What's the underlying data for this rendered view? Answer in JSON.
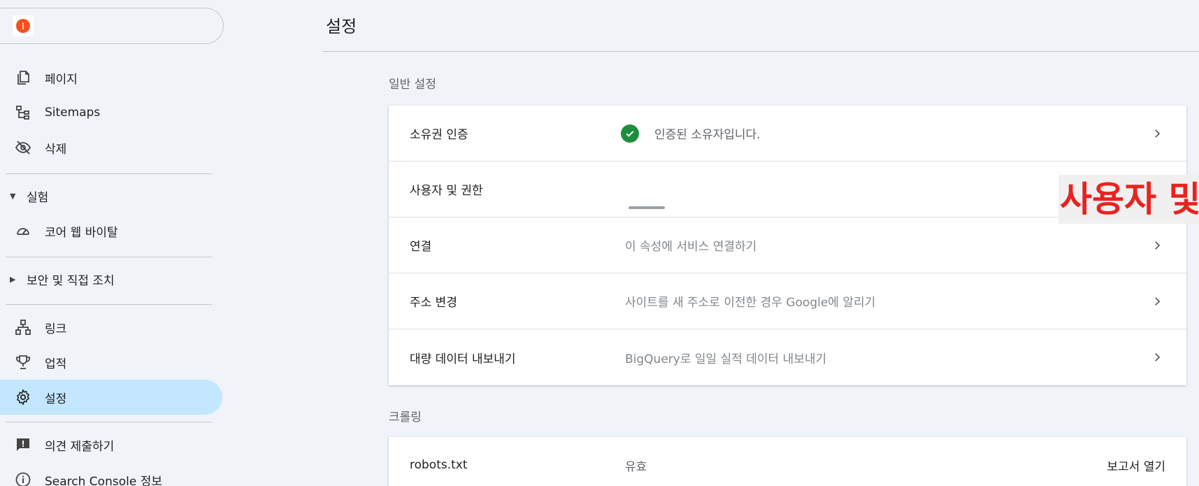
{
  "sidebar": {
    "property_logo_glyph": "⋮",
    "items": [
      {
        "label": "페이지",
        "icon": "pages-icon"
      },
      {
        "label": "Sitemaps",
        "icon": "sitemap-icon"
      },
      {
        "label": "삭제",
        "icon": "visibility-off-icon"
      }
    ],
    "group_experiment": {
      "label": "실험"
    },
    "experiment_items": [
      {
        "label": "코어 웹 바이탈",
        "icon": "speed-icon"
      }
    ],
    "group_security": {
      "label": "보안 및 직접 조치"
    },
    "bottom_items": [
      {
        "label": "링크",
        "icon": "links-icon"
      },
      {
        "label": "업적",
        "icon": "trophy-icon"
      },
      {
        "label": "설정",
        "icon": "gear-icon",
        "active": true
      }
    ],
    "footer_items": [
      {
        "label": "의견 제출하기",
        "icon": "feedback-icon"
      },
      {
        "label": "Search Console 정보",
        "icon": "info-icon"
      }
    ]
  },
  "main": {
    "title": "설정",
    "general": {
      "heading": "일반 설정",
      "rows": [
        {
          "label": "소유권 인증",
          "value": "인증된 소유자입니다."
        },
        {
          "label": "사용자 및 권한",
          "value": ""
        },
        {
          "label": "연결",
          "value": "이 속성에 서비스 연결하기"
        },
        {
          "label": "주소 변경",
          "value": "사이트를 새 주소로 이전한 경우 Google에 알리기"
        },
        {
          "label": "대량 데이터 내보내기",
          "value": "BigQuery로 일일 실적 데이터 내보내기"
        }
      ]
    },
    "crawling": {
      "heading": "크롤링",
      "rows": [
        {
          "label": "robots.txt",
          "value": "유효",
          "action": "보고서 열기"
        }
      ]
    },
    "overlay": "사용자 및"
  },
  "colors": {
    "accent": "#c2e7ff",
    "check": "#1e8e3e",
    "overlay_text": "#e8231f"
  }
}
